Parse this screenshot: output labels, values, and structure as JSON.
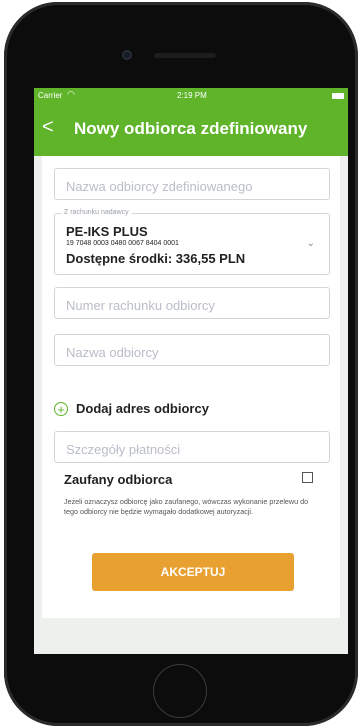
{
  "status": {
    "carrier": "Carrier",
    "time": "2:19 PM"
  },
  "header": {
    "back_glyph": "<",
    "title": "Nowy odbiorca zdefiniowany"
  },
  "form": {
    "recipient_defined_name_placeholder": "Nazwa odbiorcy zdefiniowanego",
    "from_account": {
      "legend": "Z rachunku nadawcy",
      "name": "PE-IKS PLUS",
      "number": "19 7048 0003 0480 0067 8404 0001",
      "funds": "Dostępne środki: 336,55 PLN"
    },
    "recipient_account_placeholder": "Numer rachunku odbiorcy",
    "recipient_name_placeholder": "Nazwa odbiorcy",
    "add_address_label": "Dodaj adres odbiorcy",
    "payment_details_placeholder": "Szczegóły płatności",
    "trusted_label": "Zaufany odbiorca",
    "trusted_checked": false,
    "trusted_note": "Jeżeli oznaczysz odbiorcę jako zaufanego, wówczas wykonanie przelewu do tego odbiorcy nie będzie wymagało dodatkowej autoryzacji.",
    "accept_label": "AKCEPTUJ"
  },
  "colors": {
    "accent_green": "#5fb42a",
    "accept_orange": "#e8a031"
  }
}
